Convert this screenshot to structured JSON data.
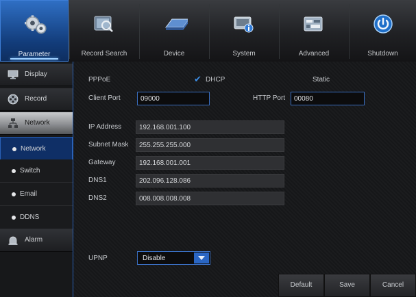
{
  "top_menu": {
    "tabs": [
      {
        "label": "Parameter",
        "icon": "gears-icon",
        "active": true
      },
      {
        "label": "Record Search",
        "icon": "record-search-icon",
        "active": false
      },
      {
        "label": "Device",
        "icon": "hard-disk-icon",
        "active": false
      },
      {
        "label": "System",
        "icon": "system-info-icon",
        "active": false
      },
      {
        "label": "Advanced",
        "icon": "advanced-settings-icon",
        "active": false
      },
      {
        "label": "Shutdown",
        "icon": "power-icon",
        "active": false
      }
    ]
  },
  "sidebar": {
    "items": [
      {
        "label": "Display",
        "icon": "monitor-icon"
      },
      {
        "label": "Record",
        "icon": "film-reel-icon"
      },
      {
        "label": "Network",
        "icon": "network-icon"
      }
    ],
    "subitems": [
      {
        "label": "Network",
        "active": true
      },
      {
        "label": "Switch",
        "active": false
      },
      {
        "label": "Email",
        "active": false
      },
      {
        "label": "DDNS",
        "active": false
      }
    ],
    "alarm": {
      "label": "Alarm",
      "icon": "alarm-icon"
    }
  },
  "network": {
    "modes": {
      "pppoe": "PPPoE",
      "dhcp": "DHCP",
      "static": "Static",
      "selected": "DHCP"
    },
    "client_port": {
      "label": "Client Port",
      "value": "09000"
    },
    "http_port": {
      "label": "HTTP Port",
      "value": "00080"
    },
    "ip_address": {
      "label": "IP Address",
      "value": "192.168.001.100"
    },
    "subnet_mask": {
      "label": "Subnet Mask",
      "value": "255.255.255.000"
    },
    "gateway": {
      "label": "Gateway",
      "value": "192.168.001.001"
    },
    "dns1": {
      "label": "DNS1",
      "value": "202.096.128.086"
    },
    "dns2": {
      "label": "DNS2",
      "value": "008.008.008.008"
    },
    "upnp": {
      "label": "UPNP",
      "value": "Disable"
    }
  },
  "buttons": {
    "default": "Default",
    "save": "Save",
    "cancel": "Cancel"
  },
  "colors": {
    "accent": "#2a66c4",
    "active_tab": "#1c4f98",
    "check": "#3d8fe8"
  }
}
